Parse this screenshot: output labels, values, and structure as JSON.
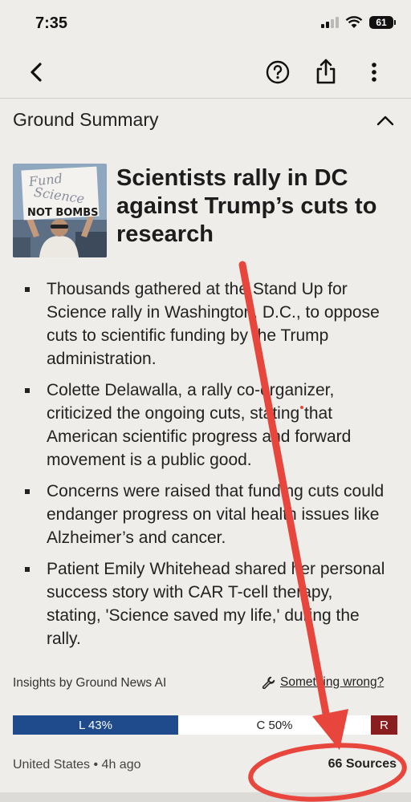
{
  "status_bar": {
    "time": "7:35",
    "battery": "61"
  },
  "nav": {
    "back_icon": "chevron-left-icon",
    "help_icon": "question-circle-icon",
    "share_icon": "share-icon",
    "more_icon": "more-vertical-icon"
  },
  "section": {
    "title": "Ground Summary",
    "toggle_icon": "chevron-up-icon"
  },
  "article": {
    "headline": "Scientists rally in DC against Trump’s cuts to research",
    "thumbnail_sign_text": [
      "Fund",
      "Science",
      "NOT BOMBS"
    ],
    "bullets": [
      "Thousands gathered at the Stand Up for Science rally in Washington, D.C., to oppose cuts to scientific funding by the Trump administration.",
      "Colette Delawalla, a rally co-organizer, criticized the ongoing cuts, stating that American scientific progress and forward movement is a public good.",
      "Concerns were raised that funding cuts could endanger progress on vital health issues like Alzheimer’s and cancer.",
      "Patient Emily Whitehead shared her personal success story with CAR T-cell therapy, stating, 'Science saved my life,' during the rally."
    ]
  },
  "insights": {
    "label": "Insights by Ground News AI",
    "wrong_label": "Something wrong?",
    "wrong_icon": "wrench-icon"
  },
  "bias": {
    "left_label": "L 43%",
    "center_label": "C 50%",
    "right_label": "R",
    "left_pct": 43,
    "center_pct": 50,
    "colors": {
      "left": "#1f4a8c",
      "center": "#ffffff",
      "right": "#8a1e1f"
    }
  },
  "footer": {
    "meta": "United States • 4h ago",
    "sources": "66 Sources"
  },
  "annotation": {
    "color": "#e8453c"
  }
}
